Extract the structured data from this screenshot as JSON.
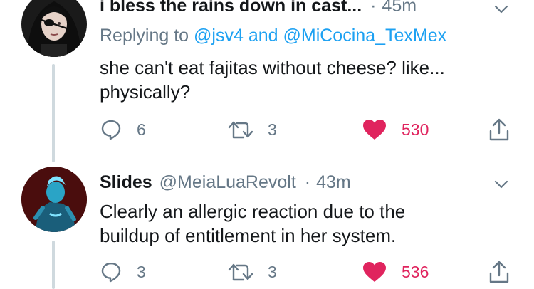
{
  "tweets": [
    {
      "display_name": "i bless the rains down in cast...",
      "time": "45m",
      "replying_prefix": "Replying to",
      "replying_user1": "@jsv4",
      "replying_and": "and",
      "replying_user2": "@MiCocina_TexMex",
      "text_lines": [
        "she can't eat fajitas without cheese? like...",
        "physically?"
      ],
      "replies": "6",
      "retweets": "3",
      "likes": "530",
      "liked": true
    },
    {
      "display_name": "Slides",
      "handle": "@MeiaLuaRevolt",
      "time": "43m",
      "text_lines": [
        "Clearly an allergic reaction due to the",
        "buildup of entitlement in her system."
      ],
      "replies": "3",
      "retweets": "3",
      "likes": "536",
      "liked": true
    }
  ],
  "separator": "·",
  "colors": {
    "link": "#1da1f2",
    "muted": "#657786",
    "like": "#e0245e",
    "thread_line": "#cfd9de"
  },
  "icons": [
    "reply-icon",
    "retweet-icon",
    "heart-icon",
    "share-icon",
    "chevron-down-icon"
  ]
}
